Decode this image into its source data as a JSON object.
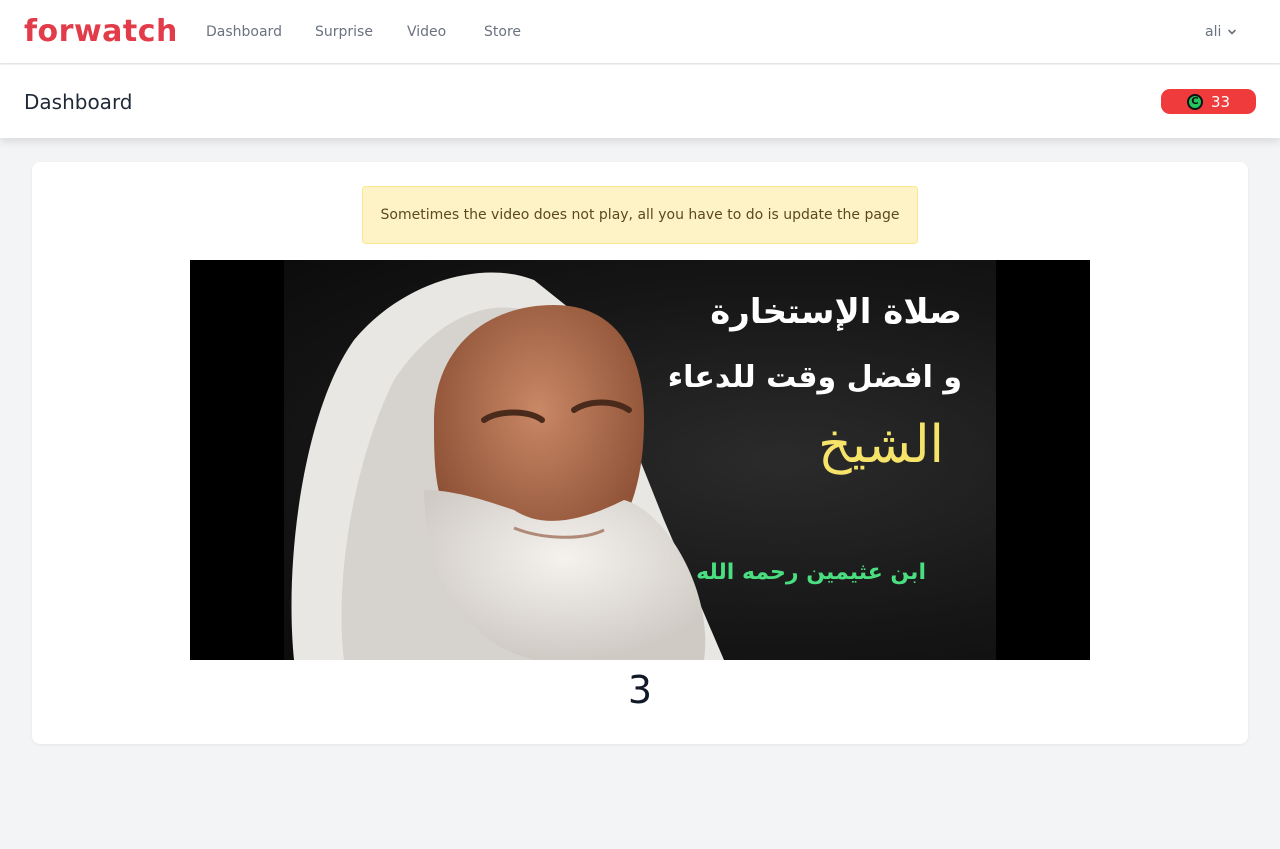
{
  "brand": {
    "logo_text": "forwatch",
    "logo_color": "#e23c4a"
  },
  "nav": {
    "items": [
      {
        "label": "Dashboard"
      },
      {
        "label": "Surprise"
      },
      {
        "label": "Video"
      },
      {
        "label": "Store"
      }
    ],
    "user": {
      "name": "ali",
      "icon": "chevron-down-icon"
    }
  },
  "header": {
    "title": "Dashboard",
    "coins": {
      "value": "33",
      "icon": "coin-icon",
      "icon_glyph": "C",
      "badge_color": "#ef3b3b"
    }
  },
  "main": {
    "alert_text": "Sometimes the video does not play, all you have to do is update the page",
    "video": {
      "text_lines": [
        "صلاة الإستخارة",
        "و افضل وقت للدعاء",
        "الشيخ",
        "ابن عثيمين رحمه الله"
      ]
    },
    "counter": "3"
  }
}
